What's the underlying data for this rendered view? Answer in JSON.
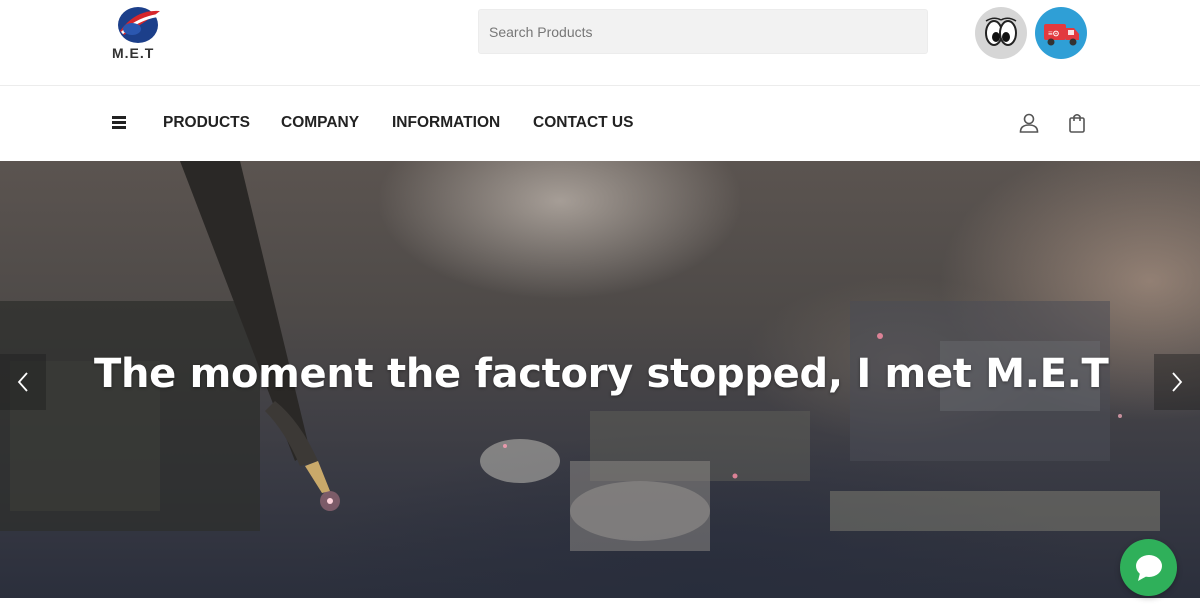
{
  "brand": {
    "logo_text": "M.E.T"
  },
  "search": {
    "placeholder": "Search Products"
  },
  "header_buttons": [
    {
      "icon": "eyes-icon"
    },
    {
      "icon": "delivery-truck-icon"
    }
  ],
  "nav": {
    "menu_icon": "hamburger-icon",
    "items": [
      {
        "label": "PRODUCTS"
      },
      {
        "label": "COMPANY"
      },
      {
        "label": "INFORMATION"
      },
      {
        "label": "CONTACT US"
      }
    ],
    "account_icon": "user-icon",
    "cart_icon": "shopping-bag-icon"
  },
  "hero": {
    "title": "The moment the factory stopped, I met M.E.T",
    "prev_icon": "chevron-left-icon",
    "next_icon": "chevron-right-icon"
  },
  "chat": {
    "icon": "chat-bubble-icon"
  },
  "colors": {
    "chat_button": "#2fb05a",
    "truck_button": "#2f9fd6",
    "logo_red": "#d6262b",
    "logo_blue": "#1c3f8a"
  }
}
